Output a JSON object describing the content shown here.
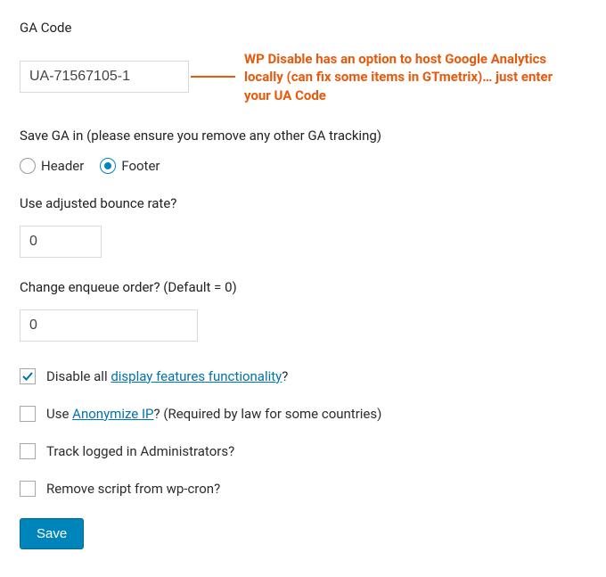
{
  "ga_code": {
    "label": "GA Code",
    "value": "UA-71567105-1"
  },
  "annotation": "WP Disable has an option to host Google Analytics locally (can fix some items in GTmetrix)… just enter your UA Code",
  "save_ga_in": {
    "label": "Save GA in (please ensure you remove any other GA tracking)",
    "options": [
      "Header",
      "Footer"
    ],
    "selected": "Footer"
  },
  "bounce_rate": {
    "label": "Use adjusted bounce rate?",
    "value": "0"
  },
  "enqueue_order": {
    "label": "Change enqueue order? (Default = 0)",
    "value": "0"
  },
  "checkboxes": {
    "disable_display": {
      "pre": "Disable all ",
      "link": "display features functionality",
      "post": "?",
      "checked": true
    },
    "anonymize": {
      "pre": "Use ",
      "link": "Anonymize IP",
      "post": "? (Required by law for some countries)",
      "checked": false
    },
    "track_admins": {
      "text": "Track logged in Administrators?",
      "checked": false
    },
    "remove_cron": {
      "text": "Remove script from wp-cron?",
      "checked": false
    }
  },
  "save_label": "Save"
}
